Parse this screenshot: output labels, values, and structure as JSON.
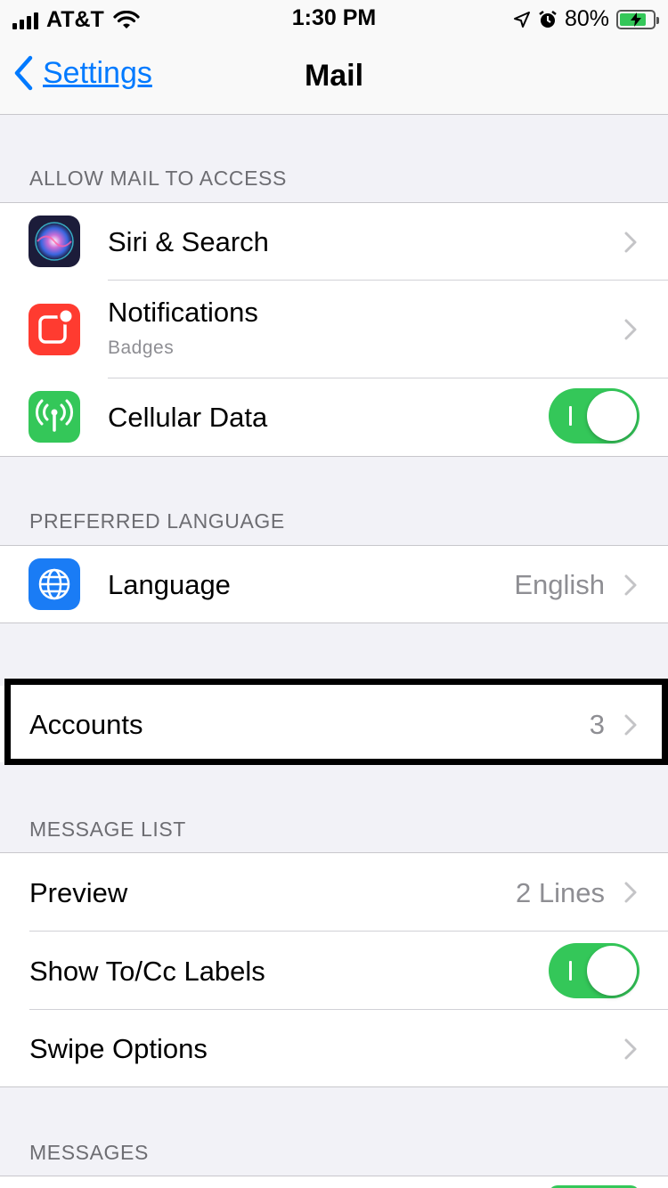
{
  "status_bar": {
    "carrier": "AT&T",
    "time": "1:30 PM",
    "battery": "80%",
    "battery_level": 0.8
  },
  "nav": {
    "back_label": "Settings",
    "title": "Mail"
  },
  "sections": {
    "allow_access": {
      "header": "ALLOW MAIL TO ACCESS",
      "siri": {
        "label": "Siri & Search",
        "icon": "siri-icon"
      },
      "notifications": {
        "label": "Notifications",
        "sub": "Badges",
        "icon": "notifications-icon"
      },
      "cellular": {
        "label": "Cellular Data",
        "icon": "antenna-icon",
        "on": true
      }
    },
    "preferred_language": {
      "header": "PREFERRED LANGUAGE",
      "language": {
        "label": "Language",
        "value": "English",
        "icon": "globe-icon"
      }
    },
    "accounts": {
      "label": "Accounts",
      "value": "3"
    },
    "message_list": {
      "header": "MESSAGE LIST",
      "preview": {
        "label": "Preview",
        "value": "2 Lines"
      },
      "show_to_cc": {
        "label": "Show To/Cc Labels",
        "on": true
      },
      "swipe_options": {
        "label": "Swipe Options"
      }
    },
    "messages": {
      "header": "MESSAGES"
    }
  },
  "colors": {
    "accent": "#007aff",
    "toggle_on": "#34c759",
    "background": "#f2f2f7"
  }
}
